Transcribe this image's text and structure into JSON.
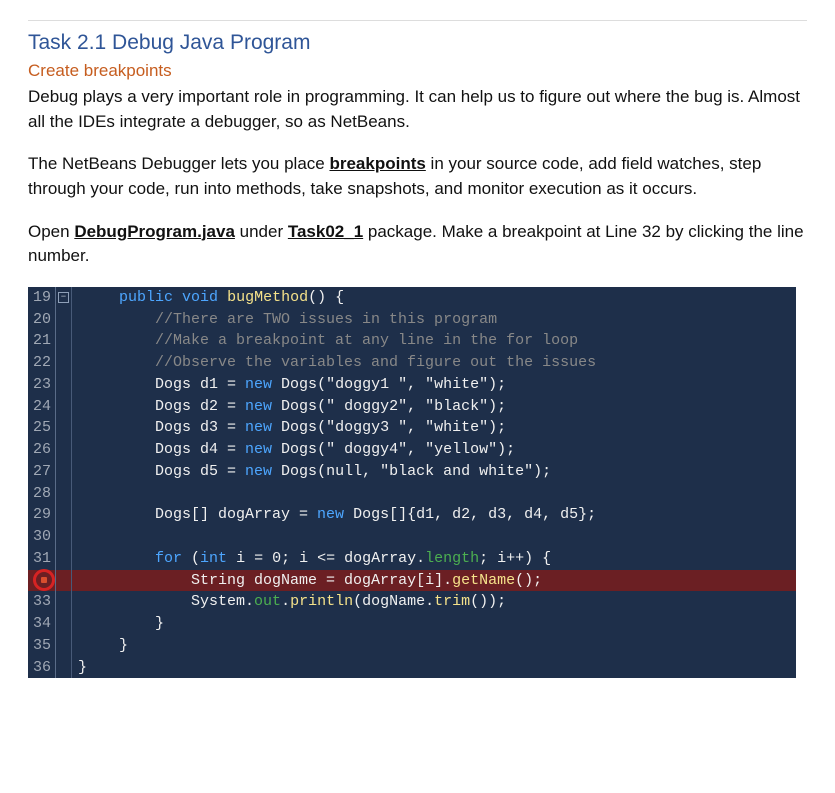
{
  "title": "Task 2.1 Debug Java Program",
  "subtitle": "Create breakpoints",
  "para1": "Debug plays a very important role in programming. It can help us to figure out where the bug is. Almost all the IDEs integrate a debugger, so as NetBeans.",
  "para2_a": "The NetBeans Debugger lets you place ",
  "para2_b": "breakpoints",
  "para2_c": " in your source code, add field watches, step through your code, run into methods, take snapshots, and monitor execution as it occurs.",
  "para3_a": "Open ",
  "para3_b": "DebugProgram.java",
  "para3_c": " under ",
  "para3_d": "Task02_1",
  "para3_e": " package. Make a breakpoint at Line 32 by clicking the line number.",
  "code": {
    "l19": {
      "n": "19",
      "kw1": "public",
      "kw2": "void",
      "fn": "bugMethod",
      "rest": "() {"
    },
    "l20": {
      "n": "20",
      "cmt": "//There are TWO issues in this program"
    },
    "l21": {
      "n": "21",
      "cmt": "//Make a breakpoint at any line in the for loop"
    },
    "l22": {
      "n": "22",
      "cmt": "//Observe the variables and figure out the issues"
    },
    "l23": {
      "n": "23",
      "pre": "Dogs d1 = ",
      "kw": "new",
      "cls": " Dogs",
      "args": "(\"doggy1 \", \"white\");"
    },
    "l24": {
      "n": "24",
      "pre": "Dogs d2 = ",
      "kw": "new",
      "cls": " Dogs",
      "args": "(\" doggy2\", \"black\");"
    },
    "l25": {
      "n": "25",
      "pre": "Dogs d3 = ",
      "kw": "new",
      "cls": " Dogs",
      "args": "(\"doggy3 \", \"white\");"
    },
    "l26": {
      "n": "26",
      "pre": "Dogs d4 = ",
      "kw": "new",
      "cls": " Dogs",
      "args": "(\" doggy4\", \"yellow\");"
    },
    "l27": {
      "n": "27",
      "pre": "Dogs d5 = ",
      "kw": "new",
      "cls": " Dogs",
      "args_a": "(",
      "null": "null",
      "args_b": ", \"black and white\");"
    },
    "l28": {
      "n": "28"
    },
    "l29": {
      "n": "29",
      "pre": "Dogs[] dogArray = ",
      "kw": "new",
      "rest": " Dogs[]{d1, d2, d3, d4, d5};"
    },
    "l30": {
      "n": "30"
    },
    "l31": {
      "n": "31",
      "kw1": "for",
      "rest1": " (",
      "kw2": "int",
      "rest2": " i = 0; i <= dogArray.",
      "prop": "length",
      "rest3": "; i++) {"
    },
    "l32": {
      "n": "",
      "pre": "String dogName = dogArray[i].",
      "fn": "getName",
      "rest": "();"
    },
    "l33": {
      "n": "33",
      "pre": "System.",
      "out": "out",
      "rest1": ".",
      "fn": "println",
      "rest2": "(dogName.",
      "fn2": "trim",
      "rest3": "());"
    },
    "l34": {
      "n": "34",
      "txt": "}"
    },
    "l35": {
      "n": "35",
      "txt": "}"
    },
    "l36": {
      "n": "36",
      "txt": "}"
    }
  }
}
